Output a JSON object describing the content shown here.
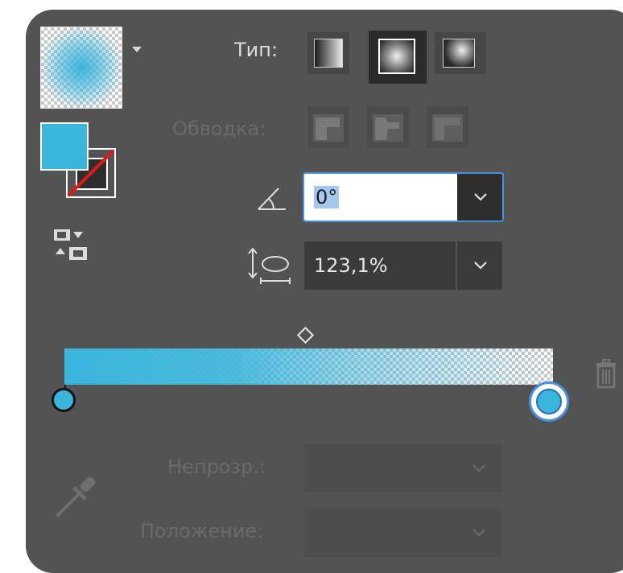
{
  "gradient_panel": {
    "type_label": "Тип:",
    "type_buttons": [
      "linear",
      "radial",
      "freeform"
    ],
    "selected_type": "radial",
    "stroke_label": "Обводка:",
    "angle": {
      "value": "0°",
      "icon": "angle-icon"
    },
    "aspect_ratio": {
      "value": "123,1%",
      "icon": "aspect-ratio-icon"
    },
    "opacity_label": "Непрозр.:",
    "position_label": "Положение:",
    "colors": {
      "accent": "#3ab5dc",
      "focus": "#4a8fe0",
      "panel_bg": "#535353"
    }
  }
}
